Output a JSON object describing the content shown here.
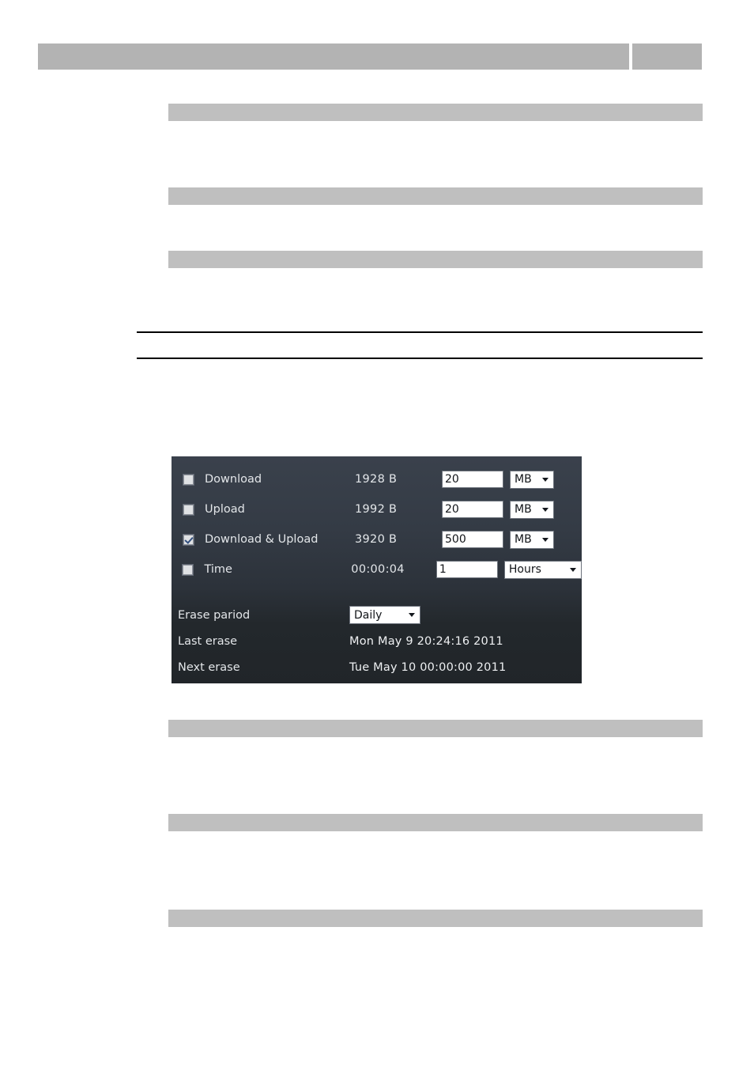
{
  "header": {
    "title_bar": "",
    "aux_bar": ""
  },
  "section_bars": [
    {
      "name": "section-bar-1",
      "text": ""
    },
    {
      "name": "section-bar-2",
      "text": ""
    },
    {
      "name": "section-bar-3",
      "text": ""
    },
    {
      "name": "section-bar-4",
      "text": ""
    },
    {
      "name": "section-bar-5",
      "text": ""
    },
    {
      "name": "section-bar-6",
      "text": ""
    }
  ],
  "traffic_meter": {
    "rows": [
      {
        "label": "Download",
        "counter": "1928 B",
        "limit": "20",
        "unit": "MB",
        "checked": false
      },
      {
        "label": "Upload",
        "counter": "1992 B",
        "limit": "20",
        "unit": "MB",
        "checked": true
      },
      {
        "label": "Download & Upload",
        "counter": "3920 B",
        "limit": "500",
        "unit": "MB",
        "checked": true
      },
      {
        "label": "Time",
        "counter": "00:00:04",
        "limit": "1",
        "unit": "Hours",
        "checked": false
      }
    ],
    "erase_period": {
      "label": "Erase pariod",
      "value": "Daily"
    },
    "last_erase": {
      "label": "Last erase",
      "value": "Mon May 9 20:24:16 2011"
    },
    "next_erase": {
      "label": "Next erase",
      "value": "Tue May 10 00:00:00 2011"
    }
  },
  "colors": {
    "panel_top": "#3a414c",
    "panel_bottom": "#212529",
    "redaction_gray": "#bfbfbf",
    "header_gray": "#b3b3b3",
    "check_blue": "#33507f",
    "text_light": "#e3e6e9"
  }
}
